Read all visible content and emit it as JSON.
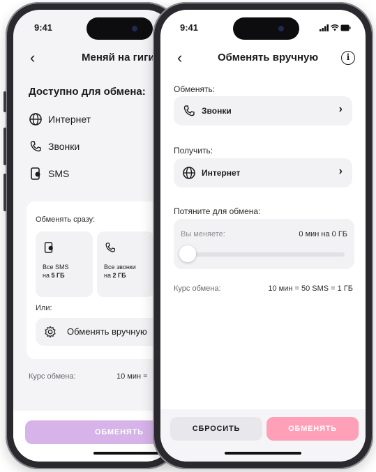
{
  "back_screen": {
    "status_time": "9:41",
    "nav_title": "Меняй на гиги",
    "available_heading": "Доступно для обмена:",
    "items": [
      {
        "label": "Интернет",
        "icon": "globe-icon"
      },
      {
        "label": "Звонки",
        "icon": "phone-icon"
      },
      {
        "label": "SMS",
        "icon": "sms-icon"
      }
    ],
    "exchange_all_label": "Обменять сразу:",
    "tiles": [
      {
        "line1": "Все SMS",
        "line2_prefix": "на ",
        "line2_value": "5 ГБ",
        "icon": "sms-icon"
      },
      {
        "line1": "Все звонки",
        "line2_prefix": "на ",
        "line2_value": "2 ГБ",
        "icon": "phone-icon"
      }
    ],
    "or_label": "Или:",
    "manual_button": "Обменять вручную",
    "rate_label": "Курс обмена:",
    "rate_value": "10 мин =",
    "exchange_button": "ОБМЕНЯТЬ"
  },
  "front_screen": {
    "status_time": "9:41",
    "nav_title": "Обменять вручную",
    "give_label": "Обменять:",
    "give_option": "Звонки",
    "receive_label": "Получить:",
    "receive_option": "Интернет",
    "slider_label": "Потяните для обмена:",
    "exchange_caption": "Вы меняете:",
    "exchange_amount": "0 мин на 0 ГБ",
    "slider_value": 0,
    "rate_label": "Курс обмена:",
    "rate_value": "10 мин = 50 SMS = 1 ГБ",
    "reset_button": "СБРОСИТЬ",
    "exchange_button": "ОБМЕНЯТЬ"
  },
  "colors": {
    "accent_pink": "#ff9fb8",
    "accent_purple": "#d6b3e8",
    "surface": "#f2f2f4",
    "text": "#1c1c1e"
  }
}
